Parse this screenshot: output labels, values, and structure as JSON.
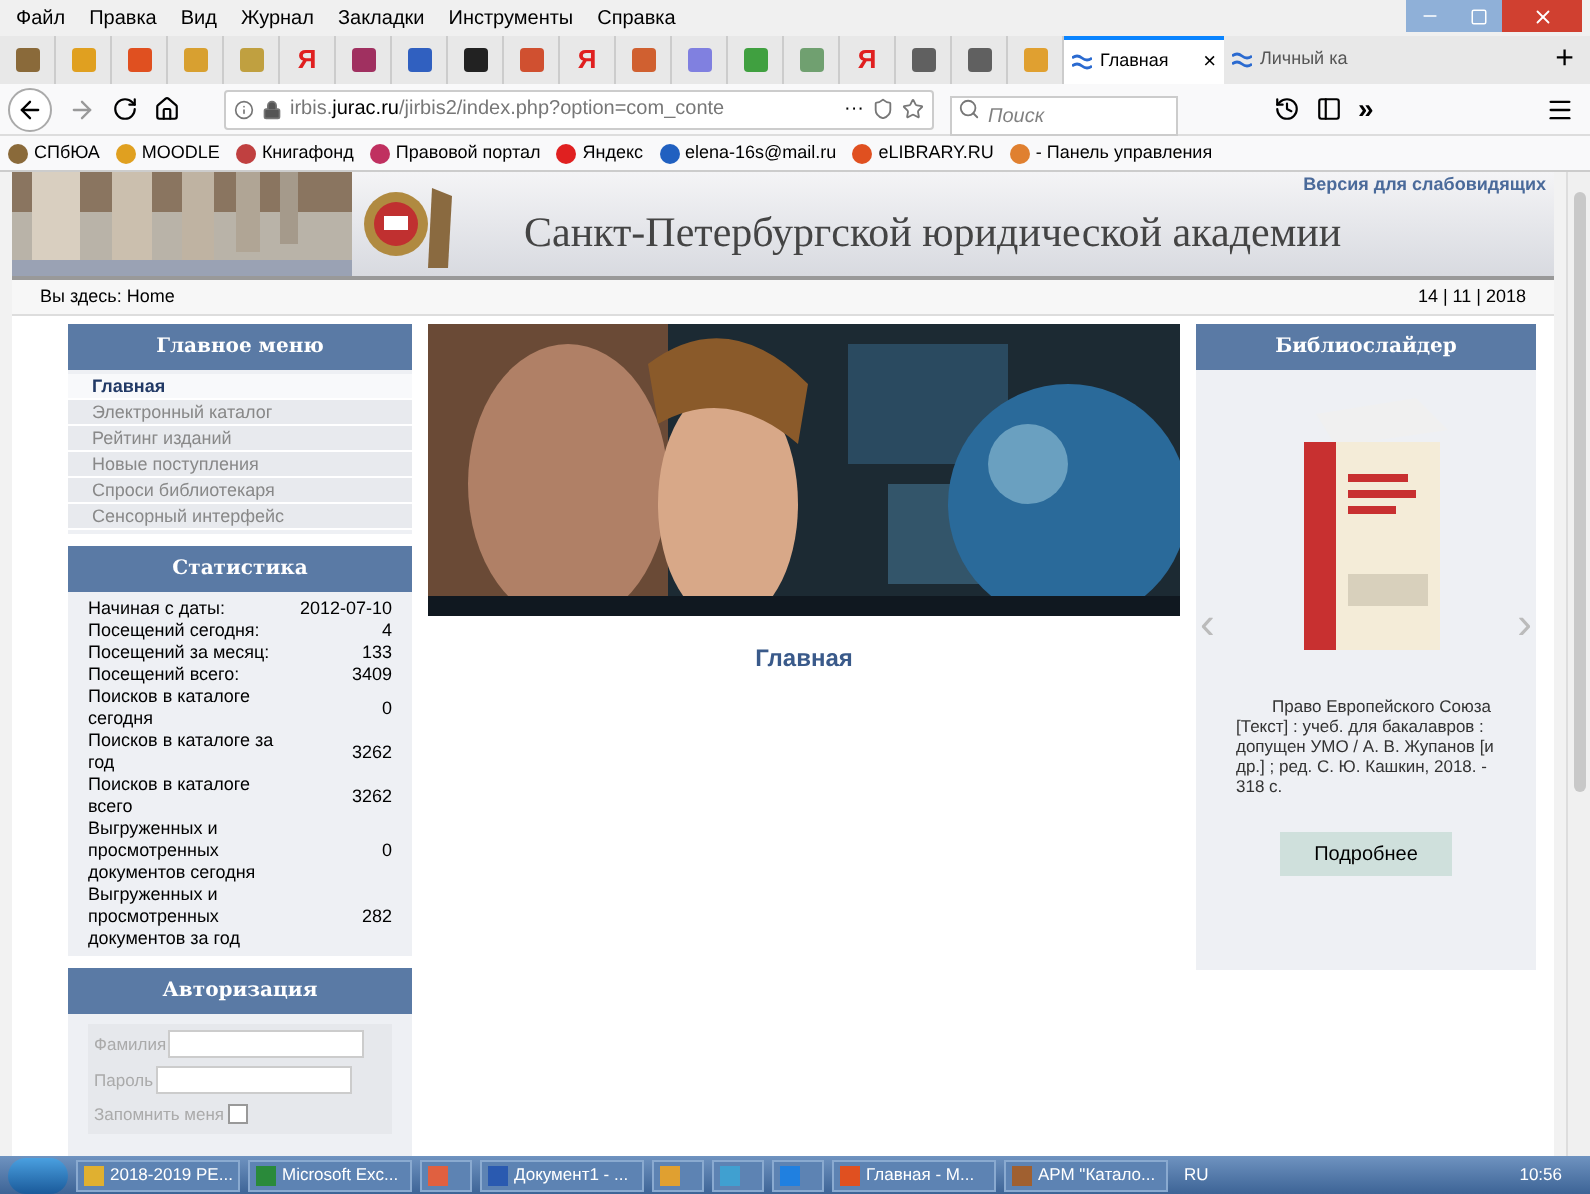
{
  "menu_bar": [
    "Файл",
    "Правка",
    "Вид",
    "Журнал",
    "Закладки",
    "Инструменты",
    "Справка"
  ],
  "pinned_tabs": [
    {
      "kind": "site",
      "color": "#8a6a3a"
    },
    {
      "kind": "site",
      "color": "#e0a020"
    },
    {
      "kind": "site",
      "color": "#e05020"
    },
    {
      "kind": "site",
      "color": "#d8a030"
    },
    {
      "kind": "site",
      "color": "#c0a040"
    },
    {
      "kind": "yandex",
      "glyph": "Я"
    },
    {
      "kind": "site",
      "color": "#a03060"
    },
    {
      "kind": "site",
      "color": "#3060c0"
    },
    {
      "kind": "site",
      "color": "#222222"
    },
    {
      "kind": "site",
      "color": "#d05030"
    },
    {
      "kind": "yandex",
      "glyph": "Я"
    },
    {
      "kind": "site",
      "color": "#d06030"
    },
    {
      "kind": "site",
      "color": "#8080e0"
    },
    {
      "kind": "site",
      "color": "#40a040"
    },
    {
      "kind": "site",
      "color": "#70a070"
    },
    {
      "kind": "yandex",
      "glyph": "Я"
    },
    {
      "kind": "site",
      "color": "#606060"
    },
    {
      "kind": "site",
      "color": "#606060"
    },
    {
      "kind": "site",
      "color": "#e0a030"
    }
  ],
  "tabs": [
    {
      "label": "Главная",
      "selected": true,
      "close": "×"
    },
    {
      "label": "Личный ка",
      "selected": false
    }
  ],
  "new_tab": "+",
  "address": {
    "host": "irbis.",
    "domain": "jurac.ru",
    "path": "/jirbis2/index.php?option=com_conte",
    "more": "···"
  },
  "search": {
    "placeholder": "Поиск"
  },
  "overflow": "»",
  "bookmarks": [
    {
      "label": "СПбЮА",
      "color": "#8a6a3a"
    },
    {
      "label": "MOODLE",
      "color": "#e0a020"
    },
    {
      "label": "Книгафонд",
      "color": "#c04040"
    },
    {
      "label": "Правовой портал",
      "color": "#c03060"
    },
    {
      "label": "Яндекс",
      "color": "#e02020"
    },
    {
      "label": "elena-16s@mail.ru",
      "color": "#2060c0"
    },
    {
      "label": "eLIBRARY.RU",
      "color": "#e05020"
    },
    {
      "label": "- Панель управления",
      "color": "#e08030"
    }
  ],
  "header": {
    "title": "Санкт-Петербургской юридической академии",
    "accessibility_link": "Версия для слабовидящих"
  },
  "breadcrumb": {
    "text": "Вы здесь: Home",
    "date": "14 | 11 | 2018"
  },
  "main_menu": {
    "title": "Главное меню",
    "items": [
      {
        "label": "Главная",
        "selected": true
      },
      {
        "label": "Электронный каталог",
        "selected": false
      },
      {
        "label": "Рейтинг изданий",
        "selected": false
      },
      {
        "label": "Новые поступления",
        "selected": false
      },
      {
        "label": "Спроси библиотекаря",
        "selected": false
      },
      {
        "label": "Сенсорный интерфейс",
        "selected": false
      }
    ]
  },
  "statistics": {
    "title": "Статистика",
    "rows": [
      {
        "label": "Начиная с даты:",
        "value": "2012-07-10"
      },
      {
        "label": "Посещений сегодня:",
        "value": "4"
      },
      {
        "label": "Посещений за месяц:",
        "value": "133"
      },
      {
        "label": "Посещений всего:",
        "value": "3409"
      },
      {
        "label": "Поисков в каталоге сегодня",
        "value": "0"
      },
      {
        "label": "Поисков в каталоге за год",
        "value": "3262"
      },
      {
        "label": "Поисков в каталоге всего",
        "value": "3262"
      },
      {
        "label": "Выгруженных и просмотренных документов сегодня",
        "value": "0"
      },
      {
        "label": "Выгруженных и просмотренных документов за год",
        "value": "282"
      }
    ]
  },
  "login": {
    "title": "Авторизация",
    "surname_label": "Фамилия",
    "password_label": "Пароль",
    "remember_label": "Запомнить меня",
    "remember_checked": false
  },
  "content": {
    "heading": "Главная"
  },
  "slider": {
    "title": "Библиослайдер",
    "prev": "‹",
    "next": "›",
    "caption": "Право Европейского Союза [Текст] : учеб. для бакалавров : допущен УМО / А. В. Жупанов [и др.] ; ред. С. Ю. Кашкин, 2018. - 318 с.",
    "button": "Подробнее"
  },
  "taskbar": {
    "items": [
      {
        "label": "2018-2019 РЕ...",
        "color": "#e0b030"
      },
      {
        "label": "Microsoft Exc...",
        "color": "#2a8a3a"
      },
      {
        "color": "#e06040"
      },
      {
        "label": "Документ1 - ...",
        "color": "#2a5ab0"
      },
      {
        "color": "#e0a030"
      },
      {
        "color": "#40a0d0"
      },
      {
        "color": "#2080e0"
      },
      {
        "label": "Главная - М...",
        "color": "#e05020"
      },
      {
        "label": "АРМ \"Катало...",
        "color": "#a06030"
      }
    ],
    "lang": "RU",
    "time": "10:56"
  }
}
